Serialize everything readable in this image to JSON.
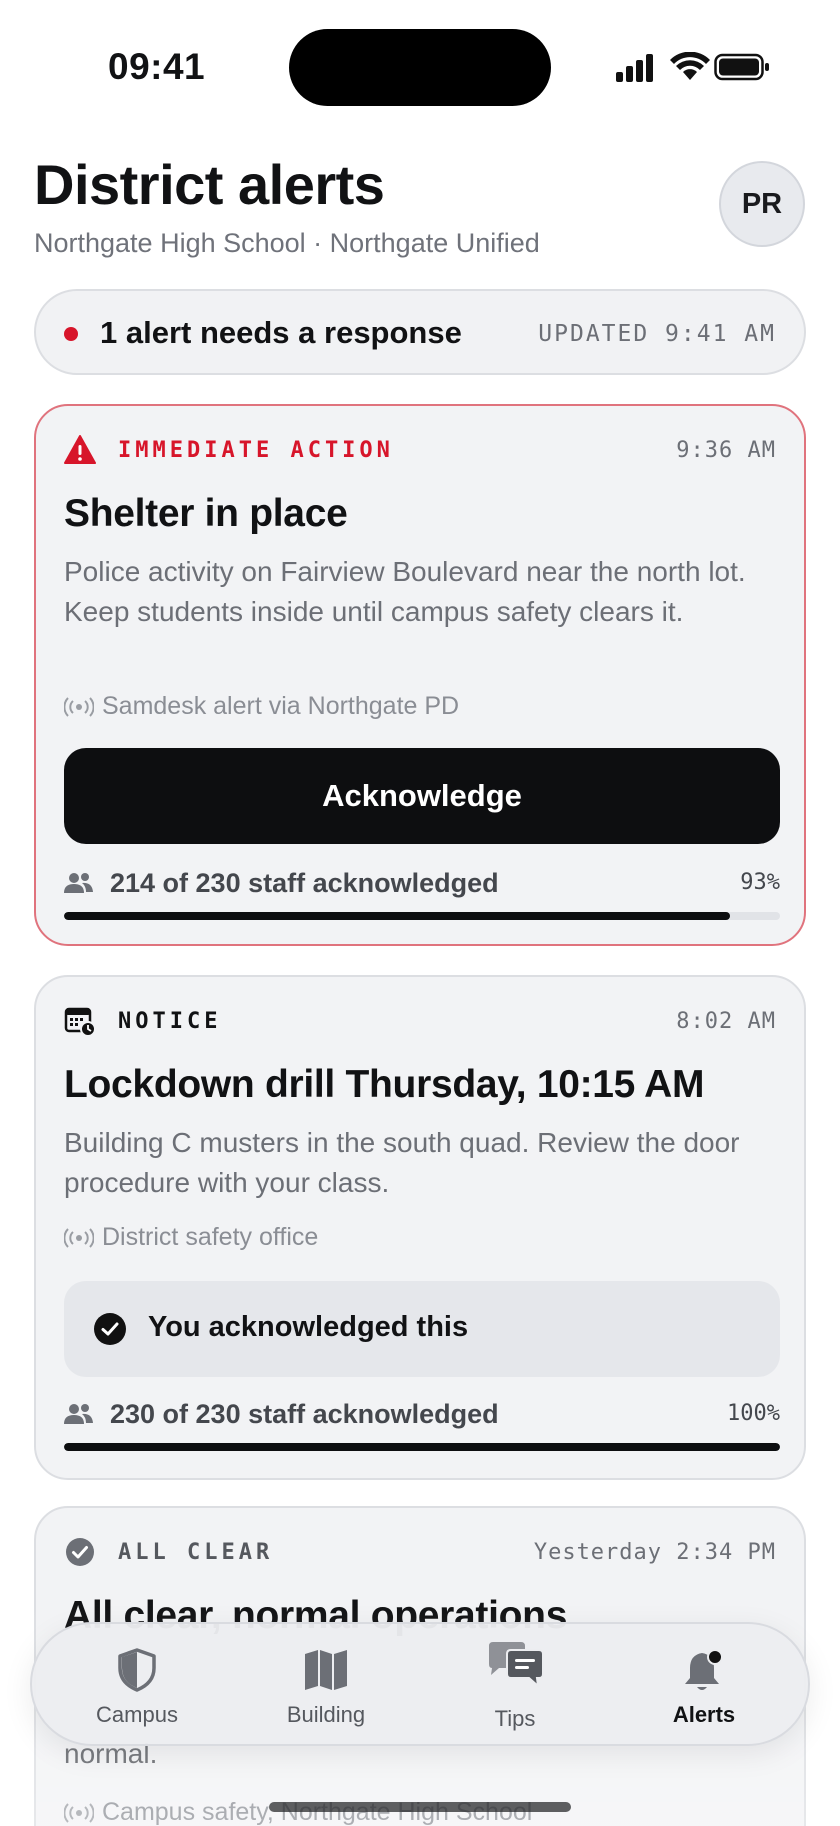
{
  "status_bar": {
    "time": "09:41"
  },
  "header": {
    "title": "District alerts",
    "subtitle": "Northgate High School · Northgate Unified",
    "avatar_initials": "PR"
  },
  "summary": {
    "text": "1 alert needs a response",
    "updated": "UPDATED 9:41 AM",
    "accent_color": "#d7152a"
  },
  "alerts": [
    {
      "tag": "IMMEDIATE ACTION",
      "time": "9:36 AM",
      "title": "Shelter in place",
      "body": "Police activity on Fairview Boulevard near the north lot. Keep students inside until campus safety clears it.",
      "source": "Samdesk alert via Northgate PD",
      "button_label": "Acknowledge",
      "staff_text": "214 of 230 staff acknowledged",
      "percent_label": "93%",
      "progress": 0.93,
      "tag_color": "#d7152a",
      "icon": "warning-triangle-icon"
    },
    {
      "tag": "NOTICE",
      "time": "8:02 AM",
      "title": "Lockdown drill Thursday, 10:15 AM",
      "body": "Building C musters in the south quad. Review the door procedure with your class.",
      "source": "District safety office",
      "acknowledged_label": "You acknowledged this",
      "staff_text": "230 of 230 staff acknowledged",
      "percent_label": "100%",
      "progress": 1.0,
      "icon": "calendar-clock-icon"
    },
    {
      "tag": "ALL CLEAR",
      "time": "Yesterday 2:34 PM",
      "title": "All clear, normal operations",
      "body_tail": "normal.",
      "source": "Campus safety, Northgate High School",
      "icon": "check-circle-icon"
    }
  ],
  "tabs": [
    {
      "label": "Campus",
      "icon": "shield-icon"
    },
    {
      "label": "Building",
      "icon": "map-icon"
    },
    {
      "label": "Tips",
      "icon": "chat-bubbles-icon"
    },
    {
      "label": "Alerts",
      "icon": "bell-icon",
      "active": true
    }
  ]
}
